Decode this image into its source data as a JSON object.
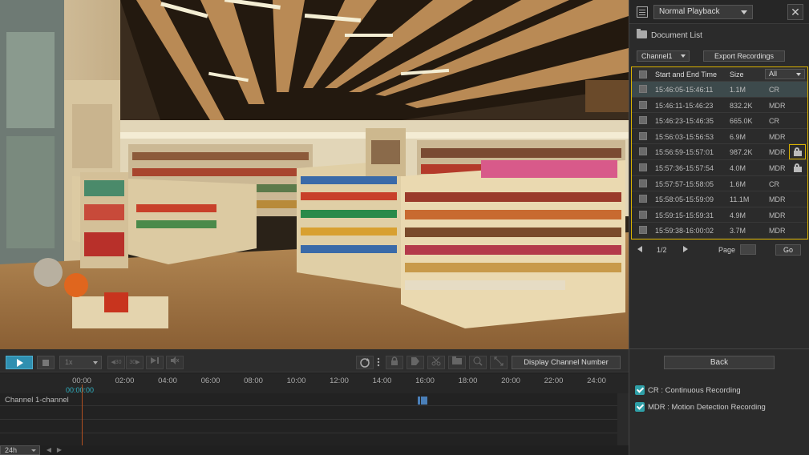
{
  "header": {
    "mode_select": "Normal Playback",
    "close_glyph": "✕",
    "doc_list_title": "Document List"
  },
  "filters": {
    "channel": "Channel1",
    "export_label": "Export Recordings"
  },
  "table": {
    "col_time": "Start and End Time",
    "col_size": "Size",
    "type_filter": "All",
    "rows": [
      {
        "time": "15:46:05-15:46:11",
        "size": "1.1M",
        "type": "CR",
        "locked": false
      },
      {
        "time": "15:46:11-15:46:23",
        "size": "832.2K",
        "type": "MDR",
        "locked": false
      },
      {
        "time": "15:46:23-15:46:35",
        "size": "665.0K",
        "type": "CR",
        "locked": false
      },
      {
        "time": "15:56:03-15:56:53",
        "size": "6.9M",
        "type": "MDR",
        "locked": false
      },
      {
        "time": "15:56:59-15:57:01",
        "size": "987.2K",
        "type": "MDR",
        "locked": true
      },
      {
        "time": "15:57:36-15:57:54",
        "size": "4.0M",
        "type": "MDR",
        "locked": true
      },
      {
        "time": "15:57:57-15:58:05",
        "size": "1.6M",
        "type": "CR",
        "locked": false
      },
      {
        "time": "15:58:05-15:59:09",
        "size": "11.1M",
        "type": "MDR",
        "locked": false
      },
      {
        "time": "15:59:15-15:59:31",
        "size": "4.9M",
        "type": "MDR",
        "locked": false
      },
      {
        "time": "15:59:38-16:00:02",
        "size": "3.7M",
        "type": "MDR",
        "locked": false
      }
    ]
  },
  "pager": {
    "page": "1/2",
    "page_label": "Page",
    "go_label": "Go"
  },
  "back_label": "Back",
  "legend": {
    "cr": "CR : Continuous Recording",
    "mdr": "MDR : Motion Detection Recording"
  },
  "controls": {
    "speed": "1x",
    "rewind_label": "◀30",
    "forward_label": "30▶",
    "display_channel_label": "Display Channel Number"
  },
  "timeline": {
    "ticks": [
      "00:00",
      "02:00",
      "04:00",
      "06:00",
      "08:00",
      "10:00",
      "12:00",
      "14:00",
      "16:00",
      "18:00",
      "20:00",
      "22:00",
      "24:00"
    ],
    "current_time": "00:00:00",
    "channel_label": "Channel 1-channel",
    "zoom": "24h"
  },
  "colors": {
    "accent": "#2f8fb0",
    "highlight_border": "#d9b200",
    "cursor": "#b05020",
    "record_segment": "#4a7fb8"
  }
}
